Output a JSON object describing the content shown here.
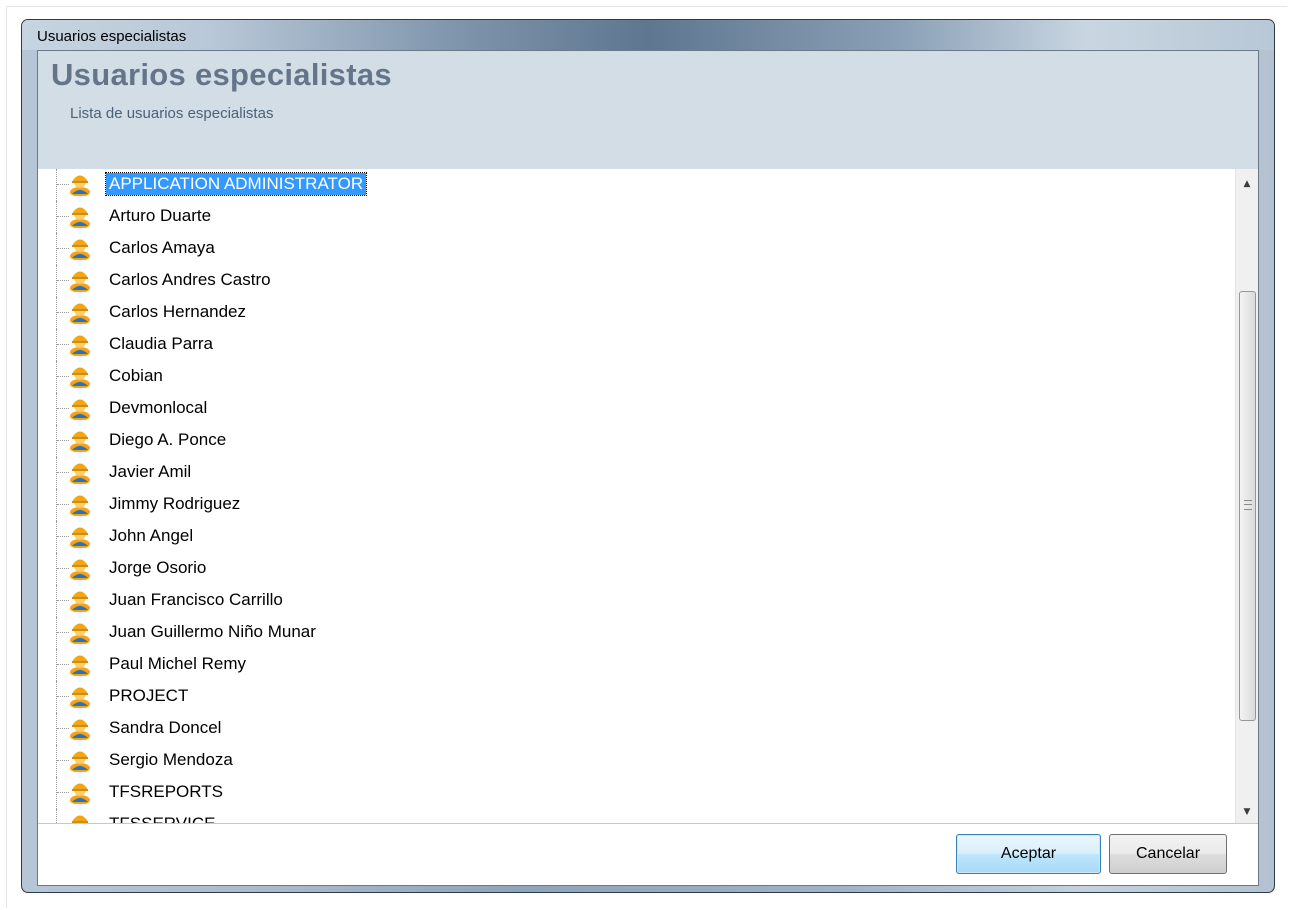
{
  "window": {
    "title": "Usuarios especialistas"
  },
  "header": {
    "title": "Usuarios especialistas",
    "subtitle": "Lista de usuarios especialistas"
  },
  "users": [
    {
      "label": "APPLICATION ADMINISTRATOR",
      "selected": true
    },
    {
      "label": "Arturo Duarte"
    },
    {
      "label": "Carlos Amaya"
    },
    {
      "label": "Carlos Andres Castro"
    },
    {
      "label": "Carlos Hernandez"
    },
    {
      "label": "Claudia Parra"
    },
    {
      "label": "Cobian"
    },
    {
      "label": "Devmonlocal"
    },
    {
      "label": "Diego A. Ponce"
    },
    {
      "label": "Javier Amil"
    },
    {
      "label": "Jimmy Rodriguez"
    },
    {
      "label": "John Angel"
    },
    {
      "label": "Jorge Osorio"
    },
    {
      "label": "Juan Francisco Carrillo"
    },
    {
      "label": "Juan Guillermo Niño Munar"
    },
    {
      "label": "Paul Michel Remy"
    },
    {
      "label": "PROJECT"
    },
    {
      "label": "Sandra Doncel"
    },
    {
      "label": "Sergio Mendoza"
    },
    {
      "label": "TFSREPORTS"
    },
    {
      "label": "TFSSERVICE"
    }
  ],
  "icons": {
    "user": "user-icon",
    "scroll_up": "scroll-up-arrow-icon",
    "scroll_down": "scroll-down-arrow-icon"
  },
  "footer": {
    "accept_label": "Aceptar",
    "cancel_label": "Cancelar"
  }
}
